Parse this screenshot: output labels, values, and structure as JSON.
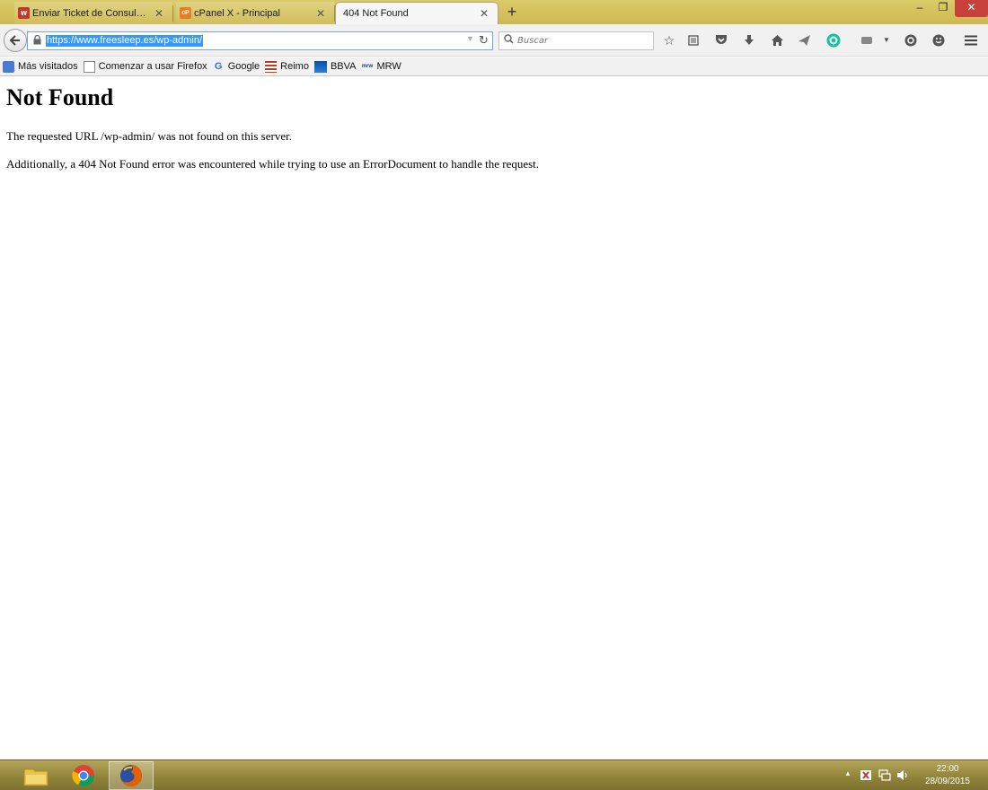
{
  "tabs": [
    {
      "label": "Enviar Ticket de Consulta ...",
      "favicon_color": "#c0392b",
      "favicon_glyph": "w"
    },
    {
      "label": "cPanel X - Principal",
      "favicon_color": "#e67e22",
      "favicon_glyph": "cP"
    },
    {
      "label": "404 Not Found"
    }
  ],
  "new_tab_icon": "plus-icon",
  "nav": {
    "url": "https://www.freesleep.es/wp-admin/",
    "search_placeholder": "Buscar"
  },
  "toolbar_icons": [
    "star-icon",
    "reading-list-icon",
    "pocket-icon",
    "download-icon",
    "home-icon",
    "send-icon",
    "grammarly-icon",
    "extension-icon",
    "dropdown-icon",
    "sync-icon",
    "smiley-icon",
    "menu-icon"
  ],
  "bookmarks": [
    {
      "label": "Más visitados",
      "icon": "most-visited-icon"
    },
    {
      "label": "Comenzar a usar Firefox",
      "icon": "page-icon"
    },
    {
      "label": "Google",
      "icon": "google-icon"
    },
    {
      "label": "Reimo",
      "icon": "flag-icon"
    },
    {
      "label": "BBVA",
      "icon": "bbva-icon"
    },
    {
      "label": "MRW",
      "icon": "mrw-icon"
    }
  ],
  "page": {
    "heading": "Not Found",
    "para1": "The requested URL /wp-admin/ was not found on this server.",
    "para2": "Additionally, a 404 Not Found error was encountered while trying to use an ErrorDocument to handle the request."
  },
  "taskbar": {
    "time": "22:00",
    "date": "28/09/2015"
  },
  "colors": {
    "titlebar": "#d4c25f",
    "url_selection": "#3399ff",
    "close_button": "#c7403a"
  }
}
